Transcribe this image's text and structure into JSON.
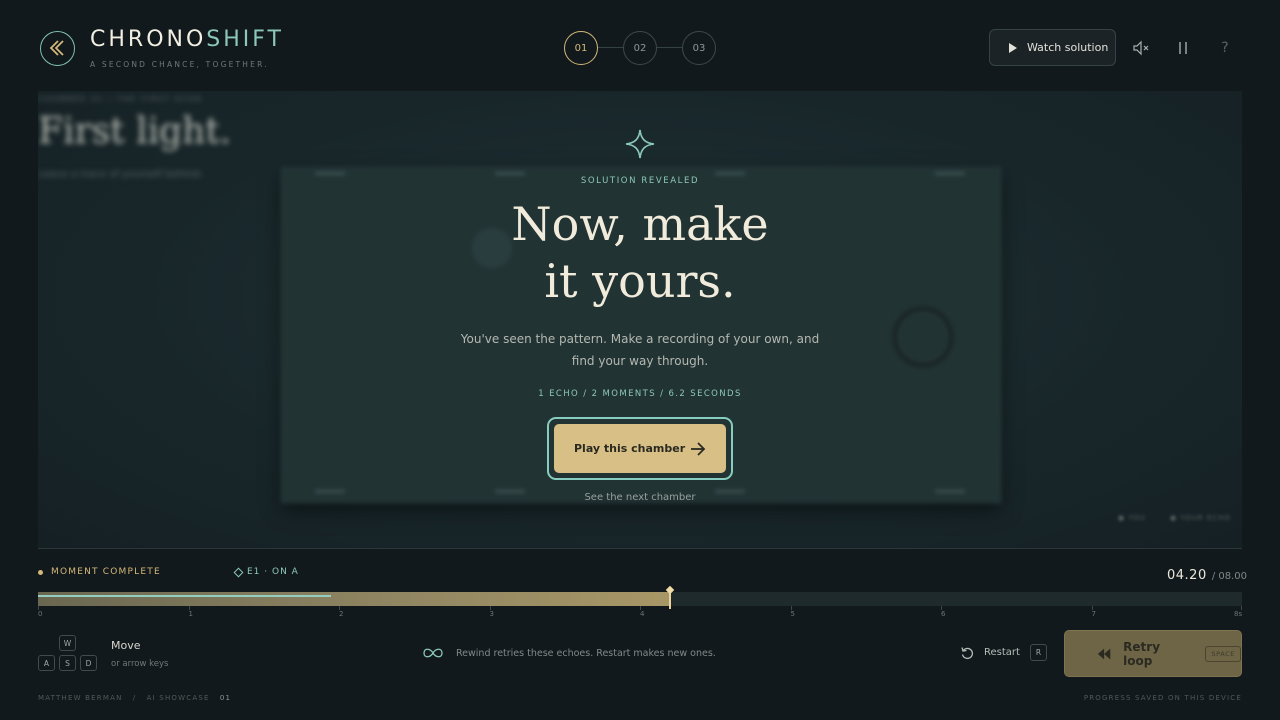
{
  "header": {
    "logo_main": "CHRONO",
    "logo_accent": "SHIFT",
    "tagline": "A SECOND CHANCE, TOGETHER.",
    "steps": [
      "01",
      "02",
      "03"
    ],
    "active_step": "01",
    "watch_label": "Watch solution",
    "icons": [
      "rewind-logo-icon",
      "mute-icon",
      "pause-icon",
      "help-icon"
    ],
    "help_glyph": "?"
  },
  "stage": {
    "crumb": "CHAMBER 01   /   THE FIRST ECHO",
    "chamber_title": "First light.",
    "chamber_sub": "Leave a trace of yourself behind.",
    "legend_1": "YOU",
    "legend_2": "YOUR ECHO",
    "overlay": {
      "eyebrow": "SOLUTION REVEALED",
      "headline_1": "Now, make",
      "headline_2": "it yours.",
      "body": "You've seen the pattern. Make a recording of your own, and find your way through.",
      "stats": "1 ECHO / 2 MOMENTS / 6.2 SECONDS",
      "play_label": "Play this chamber",
      "next_label": "See the next chamber"
    }
  },
  "timeline": {
    "status": "MOMENT COMPLETE",
    "echo_tag": "E1 · ON A",
    "current_time": "04.20",
    "total_time": "/ 08.00",
    "current_seconds": 4.2,
    "total_seconds": 8,
    "echo_end_seconds": 1.95,
    "tick_labels": [
      "0",
      "1",
      "2",
      "3",
      "4",
      "5",
      "6",
      "7",
      "8s"
    ]
  },
  "controls": {
    "keys": [
      "W",
      "A",
      "S",
      "D"
    ],
    "move_label": "Move",
    "move_sub": "or arrow keys",
    "hint": "Rewind retries these echoes. Restart makes new ones.",
    "restart_label": "Restart",
    "restart_key": "R",
    "retry_label": "Retry loop",
    "retry_key": "SPACE"
  },
  "footer": {
    "author": "MATTHEW BERMAN",
    "sep": "/",
    "showcase": "AI SHOWCASE",
    "number": "01",
    "saved": "PROGRESS SAVED ON THIS DEVICE"
  },
  "colors": {
    "background": "#12191c",
    "gold": "#d8bf86",
    "teal": "#8cc8ba"
  }
}
